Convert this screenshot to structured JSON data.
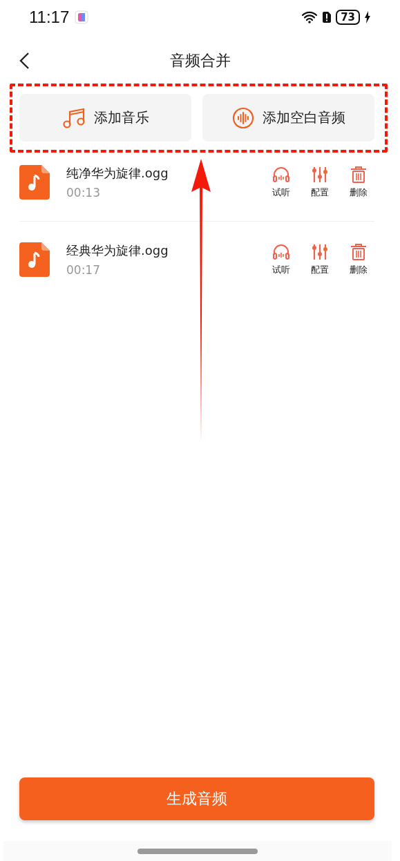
{
  "status_bar": {
    "time": "11:17",
    "battery": "73"
  },
  "header": {
    "title": "音频合并"
  },
  "add_buttons": [
    {
      "label": "添加音乐",
      "kind": "music"
    },
    {
      "label": "添加空白音频",
      "kind": "blank"
    }
  ],
  "files": [
    {
      "name": "纯净华为旋律.ogg",
      "duration": "00:13",
      "actions": [
        {
          "label": "试听",
          "kind": "listen"
        },
        {
          "label": "配置",
          "kind": "config"
        },
        {
          "label": "删除",
          "kind": "delete"
        }
      ]
    },
    {
      "name": "经典华为旋律.ogg",
      "duration": "00:17",
      "actions": [
        {
          "label": "试听",
          "kind": "listen"
        },
        {
          "label": "配置",
          "kind": "config"
        },
        {
          "label": "删除",
          "kind": "delete"
        }
      ]
    }
  ],
  "generate_button": {
    "label": "生成音频"
  }
}
